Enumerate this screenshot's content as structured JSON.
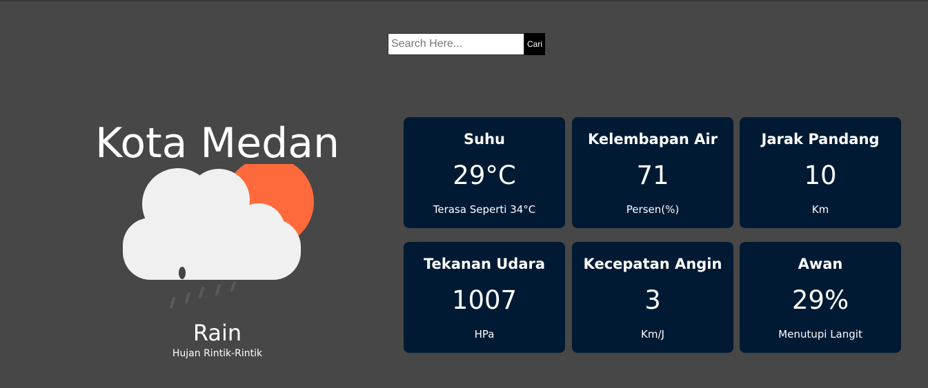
{
  "search": {
    "placeholder": "Search Here...",
    "value": "",
    "button_label": "Cari"
  },
  "location": {
    "city": "Kota Medan"
  },
  "condition": {
    "icon": "rain-cloud-sun-icon",
    "main": "Rain",
    "description": "Hujan Rintik-Rintik"
  },
  "colors": {
    "background": "#474747",
    "card": "#001a33",
    "sun": "#ff6a3d",
    "cloud": "#f0f0f0"
  },
  "cards": [
    {
      "title": "Suhu",
      "value": "29°C",
      "unit": "Terasa Seperti 34°C"
    },
    {
      "title": "Kelembapan Air",
      "value": "71",
      "unit": "Persen(%)"
    },
    {
      "title": "Jarak Pandang",
      "value": "10",
      "unit": "Km"
    },
    {
      "title": "Tekanan Udara",
      "value": "1007",
      "unit": "HPa"
    },
    {
      "title": "Kecepatan Angin",
      "value": "3",
      "unit": "Km/J"
    },
    {
      "title": "Awan",
      "value": "29%",
      "unit": "Menutupi Langit"
    }
  ]
}
